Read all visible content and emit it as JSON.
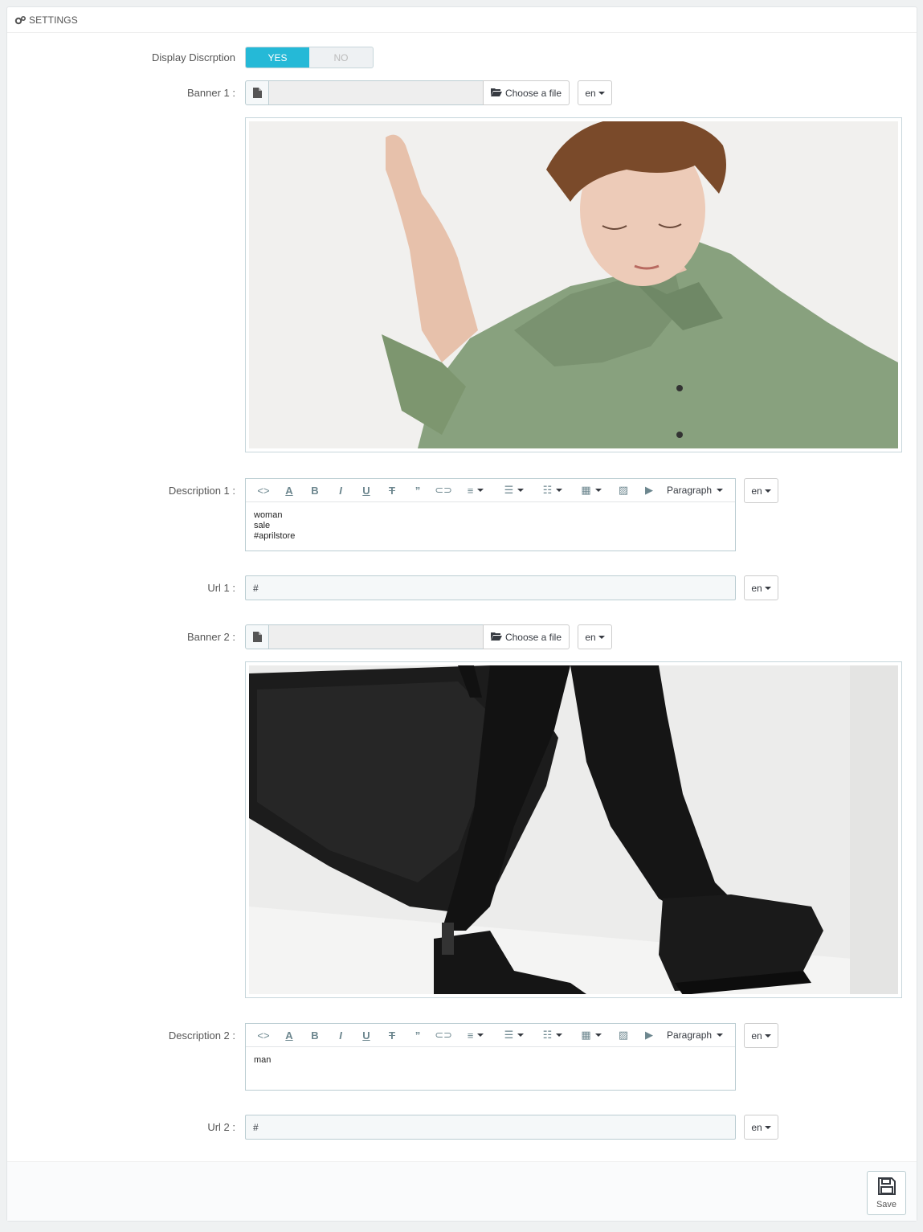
{
  "panel": {
    "title": "SETTINGS",
    "icon": "cogs-icon"
  },
  "display_description": {
    "label": "Display Discrption",
    "yes_label": "YES",
    "no_label": "NO",
    "selected": "YES"
  },
  "banner1": {
    "label": "Banner 1 :",
    "choose_label": "Choose a file",
    "file_value": "",
    "lang": "en",
    "image_alt": "woman in green shirt"
  },
  "description1": {
    "label": "Description 1 :",
    "lang": "en",
    "format": "Paragraph",
    "lines": [
      "woman",
      "sale",
      "#aprilstore"
    ]
  },
  "url1": {
    "label": "Url 1 :",
    "value": "#",
    "lang": "en"
  },
  "banner2": {
    "label": "Banner 2 :",
    "choose_label": "Choose a file",
    "file_value": "",
    "lang": "en",
    "image_alt": "man walking with black bag"
  },
  "description2": {
    "label": "Description 2 :",
    "lang": "en",
    "format": "Paragraph",
    "lines": [
      "man"
    ]
  },
  "url2": {
    "label": "Url 2 :",
    "value": "#",
    "lang": "en"
  },
  "toolbar_icons": [
    "code-icon",
    "font-color-icon",
    "bold-icon",
    "italic-icon",
    "underline-icon",
    "strikethrough-icon",
    "blockquote-icon",
    "link-icon",
    "align-icon",
    "bullet-list-icon",
    "numbered-list-icon",
    "table-icon",
    "image-icon",
    "media-icon"
  ],
  "footer": {
    "save_label": "Save"
  },
  "colors": {
    "accent": "#25b9d7",
    "border": "#bbcdd2"
  }
}
